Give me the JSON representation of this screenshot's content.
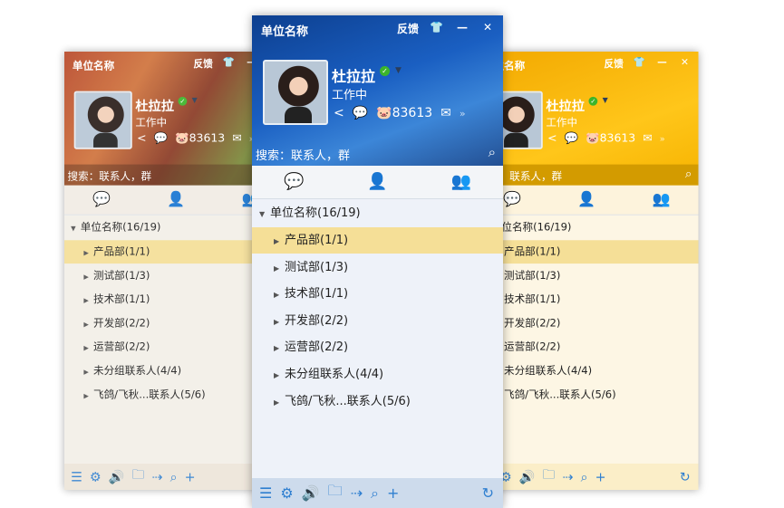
{
  "window": {
    "title": "单位名称",
    "feedback": "反馈",
    "skin_icon": "shirt-icon",
    "min": "—",
    "close": "✕",
    "user": {
      "name": "杜拉拉",
      "status": "工作中",
      "points": "83613"
    },
    "search_placeholder": "搜索：联系人，群",
    "tabs": [
      "recent-chats",
      "contacts",
      "groups"
    ],
    "root": {
      "label": "单位名称(16/19)"
    },
    "groups": [
      {
        "label": "产品部(1/1)",
        "selected": true
      },
      {
        "label": "测试部(1/3)"
      },
      {
        "label": "技术部(1/1)"
      },
      {
        "label": "开发部(2/2)"
      },
      {
        "label": "运营部(2/2)"
      },
      {
        "label": "未分组联系人(4/4)"
      },
      {
        "label": "飞鸽/飞秋...联系人(5/6)"
      }
    ]
  },
  "themes": {
    "blue": "#1a5fc2",
    "yellow": "#ffc61a",
    "autumn": "#c8603a",
    "selected_row": "#f5df97"
  }
}
